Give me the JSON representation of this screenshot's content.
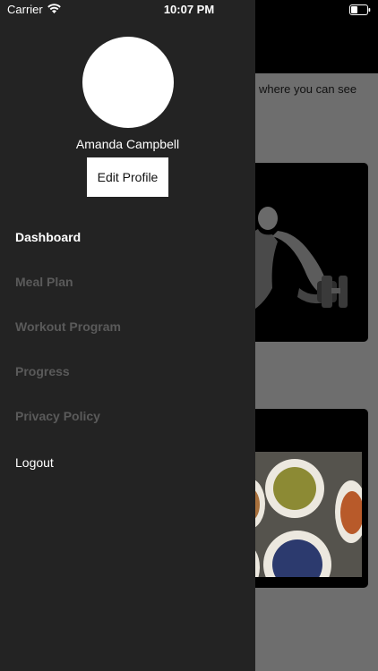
{
  "status_bar": {
    "carrier": "Carrier",
    "time": "10:07 PM"
  },
  "drawer": {
    "user_name": "Amanda Campbell",
    "edit_profile_label": "Edit Profile",
    "menu": {
      "dashboard": "Dashboard",
      "meal_plan": "Meal Plan",
      "workout_program": "Workout Program",
      "progress": "Progress",
      "privacy_policy": "Privacy Policy",
      "logout": "Logout"
    }
  },
  "background": {
    "intro_text": "where you can see"
  },
  "colors": {
    "drawer_bg": "#232323",
    "active_item": "#ffffff",
    "inactive_item": "#5a5a5a",
    "overlay": "#6e6e6e"
  }
}
